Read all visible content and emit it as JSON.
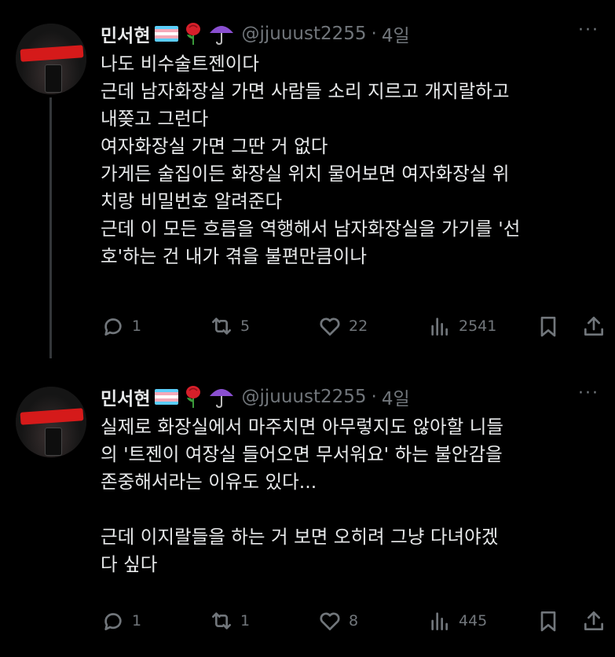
{
  "tweets": [
    {
      "author": {
        "name": "민서현",
        "emojis": [
          "rose-emoji",
          "umbrella-emoji"
        ],
        "handle": "@jjuuust2255",
        "time": "4일"
      },
      "text": "나도 비수술트젠이다\n근데 남자화장실 가면 사람들 소리 지르고 개지랄하고\n내쫒고 그런다\n여자화장실 가면 그딴 거 없다\n가게든 술집이든 화장실 위치 물어보면 여자화장실 위\n치랑 비밀번호 알려준다\n근데 이 모든 흐름을 역행해서 남자화장실을 가기를 '선\n호'하는 건 내가 겪을 불편만큼이나",
      "stats": {
        "replies": "1",
        "reposts": "5",
        "likes": "22",
        "views": "2541"
      }
    },
    {
      "author": {
        "name": "민서현",
        "emojis": [
          "rose-emoji",
          "umbrella-emoji"
        ],
        "handle": "@jjuuust2255",
        "time": "4일"
      },
      "text": "실제로 화장실에서 마주치면 아무렇지도 않아할 니들\n의 '트젠이 여장실 들어오면 무서워요' 하는 불안감을\n존중해서라는 이유도 있다...\n\n근데 이지랄들을 하는 거 보면 오히려 그냥 다녀야겠\n다 싶다",
      "stats": {
        "replies": "1",
        "reposts": "1",
        "likes": "8",
        "views": "445"
      }
    }
  ],
  "common": {
    "separator": "·",
    "more": "···"
  },
  "colors": {
    "background": "#000000",
    "text": "#e7e9ea",
    "muted": "#71767b",
    "flag": [
      "#5bcefa",
      "#f5a9b8",
      "#ffffff",
      "#f5a9b8",
      "#5bcefa"
    ]
  }
}
